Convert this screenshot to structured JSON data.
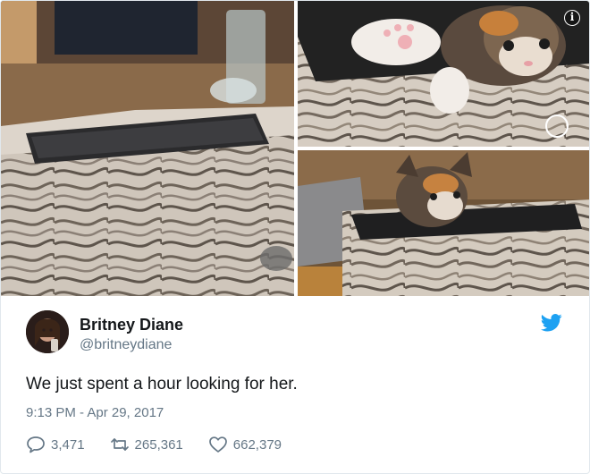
{
  "user": {
    "display_name": "Britney Diane",
    "handle": "@britneydiane"
  },
  "tweet": {
    "text": "We just spent a hour looking for her.",
    "timestamp": "9:13 PM - Apr 29, 2017"
  },
  "stats": {
    "replies": "3,471",
    "retweets": "265,361",
    "likes": "662,379"
  },
  "icons": {
    "info": "info-icon",
    "bird": "twitter-bird-icon",
    "reply": "reply-icon",
    "retweet": "retweet-icon",
    "like": "heart-icon"
  },
  "colors": {
    "brand": "#1da1f2",
    "secondary_text": "#657786",
    "primary_text": "#14171a",
    "border": "#e1e8ed"
  },
  "media": {
    "info_glyph": "i"
  }
}
